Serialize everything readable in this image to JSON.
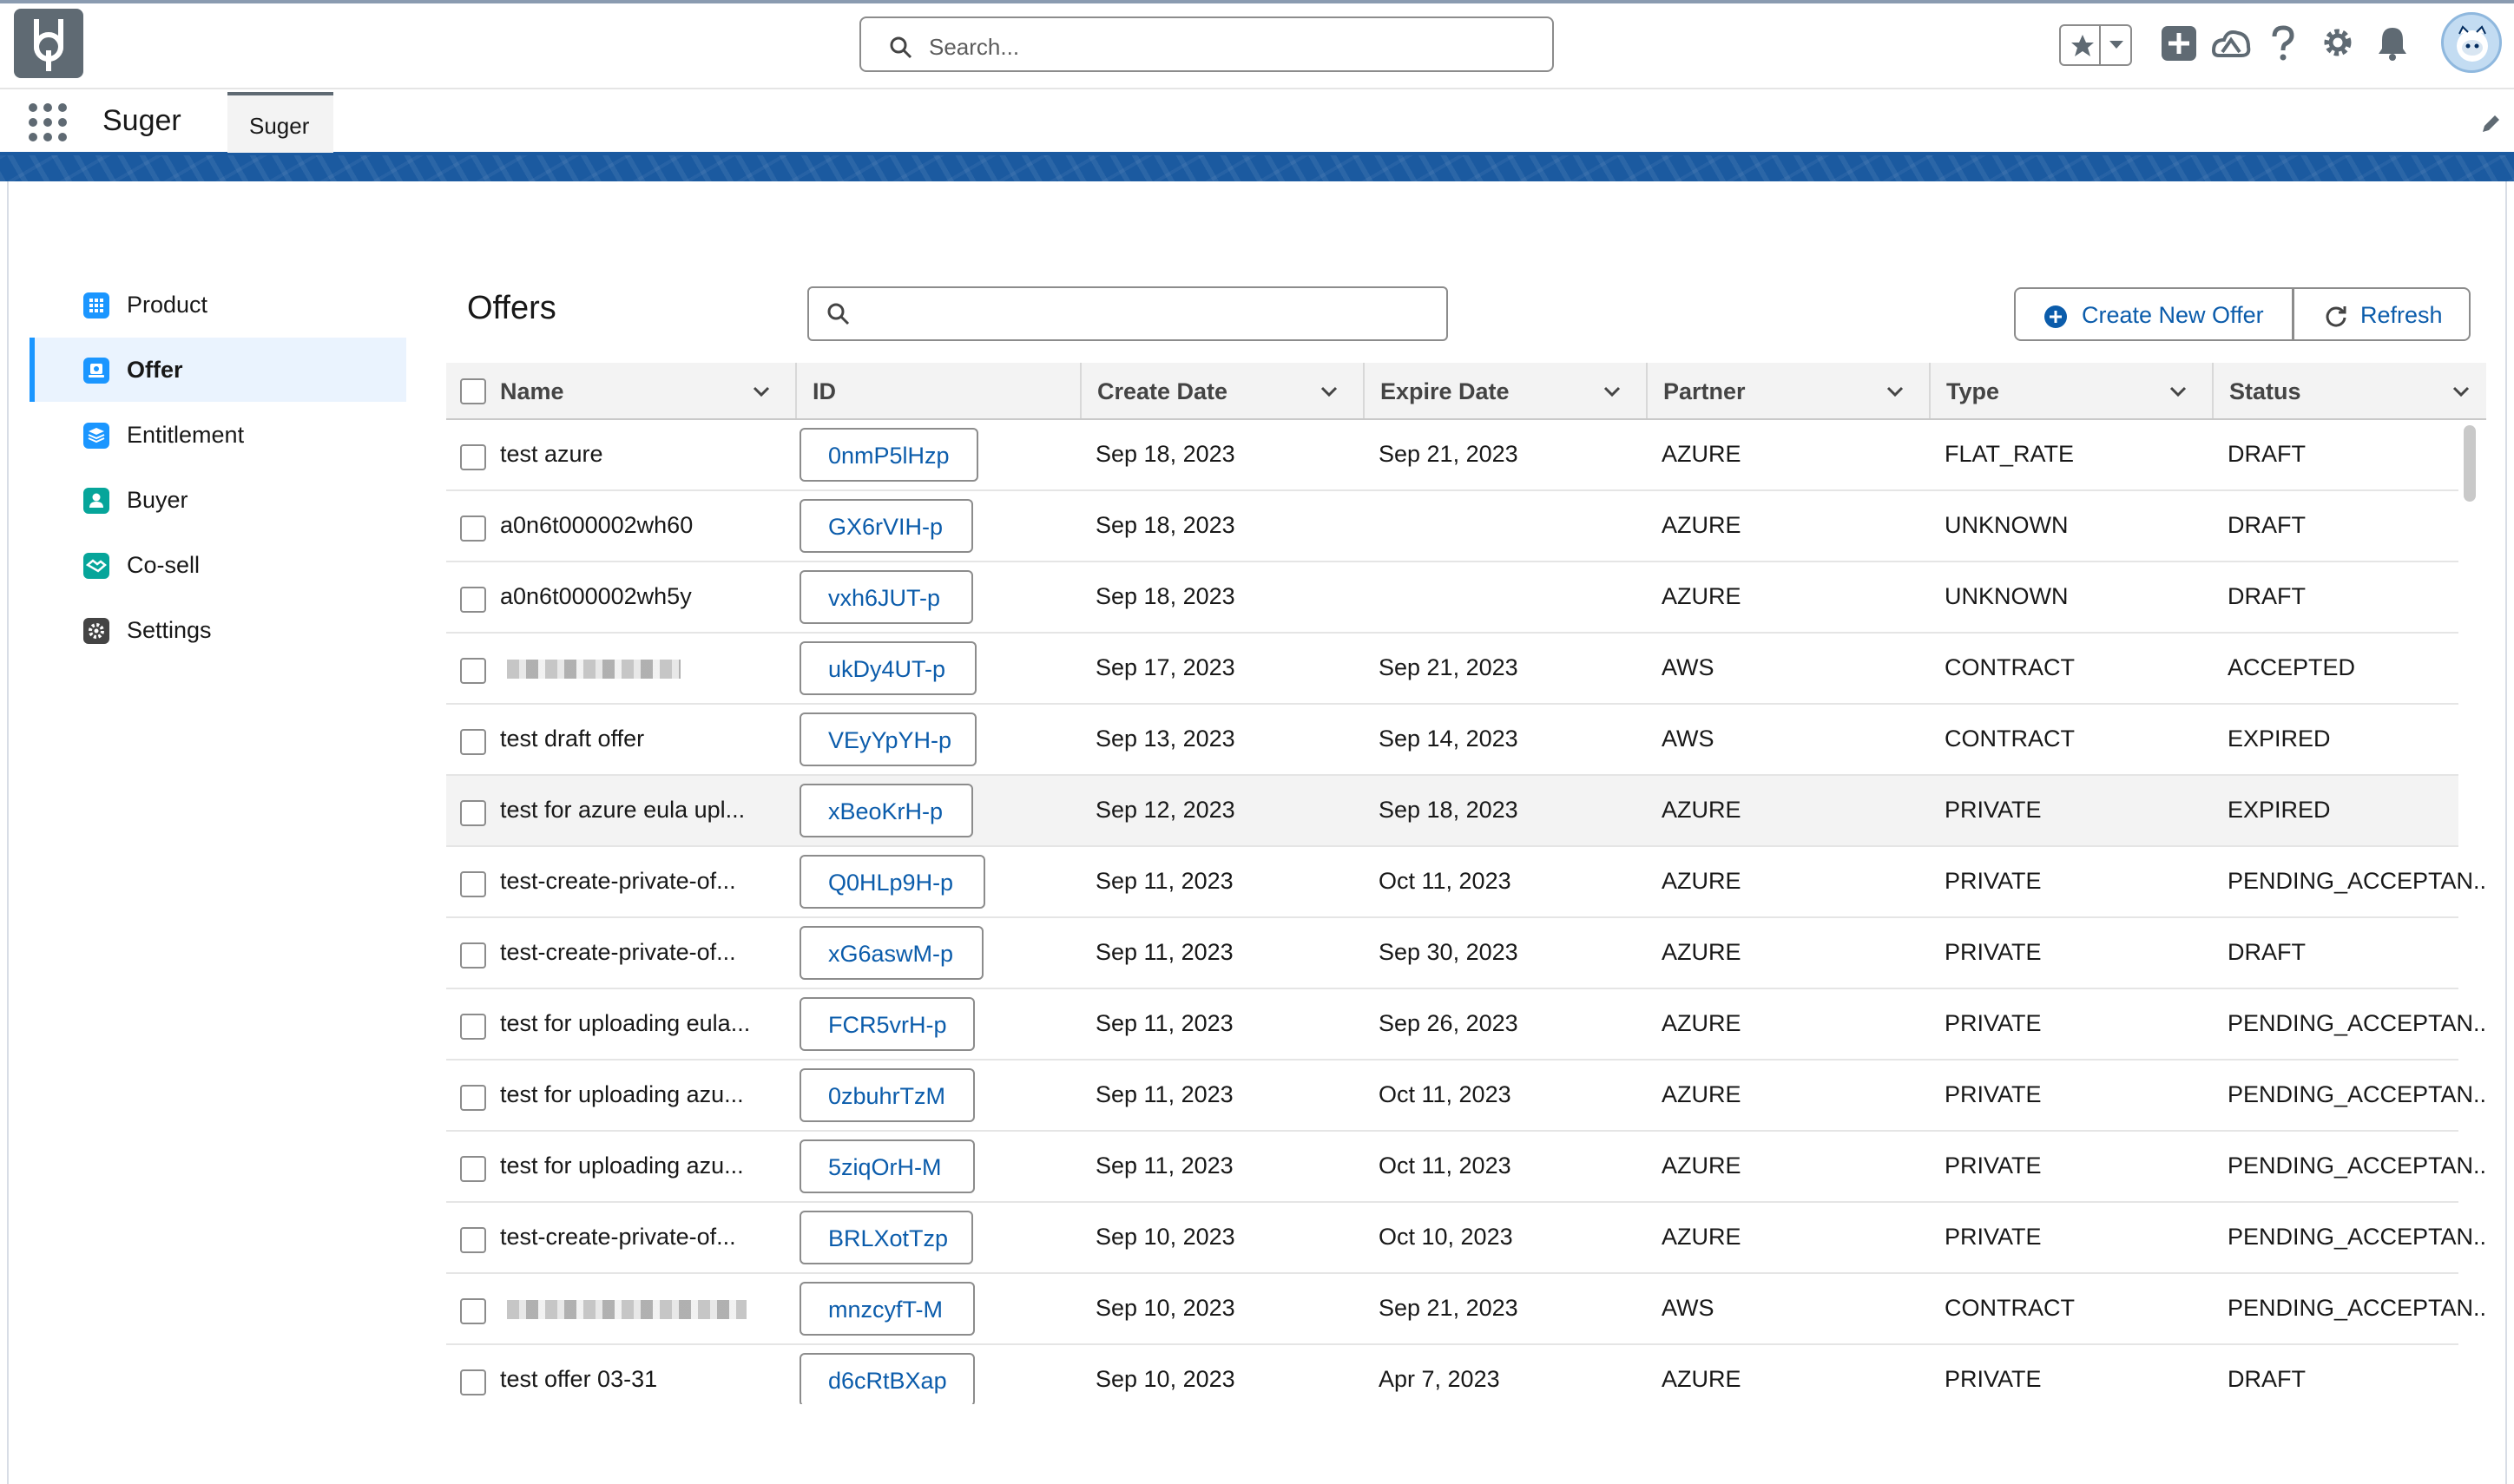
{
  "header": {
    "search_placeholder": "Search..."
  },
  "app_nav": {
    "app_name": "Suger",
    "tab_label": "Suger"
  },
  "sidebar": {
    "items": [
      {
        "label": "Product",
        "icon": "grid-icon",
        "color": "#1b96ff"
      },
      {
        "label": "Offer",
        "icon": "offer-icon",
        "color": "#1b96ff",
        "active": true
      },
      {
        "label": "Entitlement",
        "icon": "stack-icon",
        "color": "#1b96ff"
      },
      {
        "label": "Buyer",
        "icon": "person-icon",
        "color": "#06a59a"
      },
      {
        "label": "Co-sell",
        "icon": "handshake-icon",
        "color": "#06a59a"
      },
      {
        "label": "Settings",
        "icon": "gear-icon",
        "color": "#444444"
      }
    ]
  },
  "offers": {
    "title": "Offers",
    "create_label": "Create New Offer",
    "refresh_label": "Refresh",
    "columns": [
      "Name",
      "ID",
      "Create Date",
      "Expire Date",
      "Partner",
      "Type",
      "Status"
    ],
    "rows": [
      {
        "name": "test azure",
        "id": "0nmP5lHzp",
        "create": "Sep 18, 2023",
        "expire": "Sep 21, 2023",
        "partner": "AZURE",
        "type": "FLAT_RATE",
        "status": "DRAFT"
      },
      {
        "name": "a0n6t000002wh60",
        "id": "GX6rVIH-p",
        "create": "Sep 18, 2023",
        "expire": "",
        "partner": "AZURE",
        "type": "UNKNOWN",
        "status": "DRAFT"
      },
      {
        "name": "a0n6t000002wh5y",
        "id": "vxh6JUT-p",
        "create": "Sep 18, 2023",
        "expire": "",
        "partner": "AZURE",
        "type": "UNKNOWN",
        "status": "DRAFT"
      },
      {
        "name": "",
        "blurred": true,
        "id": "ukDy4UT-p",
        "create": "Sep 17, 2023",
        "expire": "Sep 21, 2023",
        "partner": "AWS",
        "type": "CONTRACT",
        "status": "ACCEPTED"
      },
      {
        "name": "test draft offer",
        "id": "VEyYpYH-p",
        "create": "Sep 13, 2023",
        "expire": "Sep 14, 2023",
        "partner": "AWS",
        "type": "CONTRACT",
        "status": "EXPIRED"
      },
      {
        "name": "test for azure eula upl...",
        "id": "xBeoKrH-p",
        "create": "Sep 12, 2023",
        "expire": "Sep 18, 2023",
        "partner": "AZURE",
        "type": "PRIVATE",
        "status": "EXPIRED",
        "highlight": true
      },
      {
        "name": "test-create-private-of...",
        "id": "Q0HLp9H-p",
        "create": "Sep 11, 2023",
        "expire": "Oct 11, 2023",
        "partner": "AZURE",
        "type": "PRIVATE",
        "status": "PENDING_ACCEPTAN..."
      },
      {
        "name": "test-create-private-of...",
        "id": "xG6aswM-p",
        "create": "Sep 11, 2023",
        "expire": "Sep 30, 2023",
        "partner": "AZURE",
        "type": "PRIVATE",
        "status": "DRAFT"
      },
      {
        "name": "test for uploading eula...",
        "id": "FCR5vrH-p",
        "create": "Sep 11, 2023",
        "expire": "Sep 26, 2023",
        "partner": "AZURE",
        "type": "PRIVATE",
        "status": "PENDING_ACCEPTAN..."
      },
      {
        "name": "test for uploading azu...",
        "id": "0zbuhrTzM",
        "create": "Sep 11, 2023",
        "expire": "Oct 11, 2023",
        "partner": "AZURE",
        "type": "PRIVATE",
        "status": "PENDING_ACCEPTAN..."
      },
      {
        "name": "test for uploading azu...",
        "id": "5ziqOrH-M",
        "create": "Sep 11, 2023",
        "expire": "Oct 11, 2023",
        "partner": "AZURE",
        "type": "PRIVATE",
        "status": "PENDING_ACCEPTAN..."
      },
      {
        "name": "test-create-private-of...",
        "id": "BRLXotTzp",
        "create": "Sep 10, 2023",
        "expire": "Oct 10, 2023",
        "partner": "AZURE",
        "type": "PRIVATE",
        "status": "PENDING_ACCEPTAN..."
      },
      {
        "name": "",
        "blurred": true,
        "id": "mnzcyfT-M",
        "create": "Sep 10, 2023",
        "expire": "Sep 21, 2023",
        "partner": "AWS",
        "type": "CONTRACT",
        "status": "PENDING_ACCEPTAN..."
      },
      {
        "name": "test offer 03-31",
        "id": "d6cRtBXap",
        "create": "Sep 10, 2023",
        "expire": "Apr 7, 2023",
        "partner": "AZURE",
        "type": "PRIVATE",
        "status": "DRAFT"
      }
    ]
  }
}
